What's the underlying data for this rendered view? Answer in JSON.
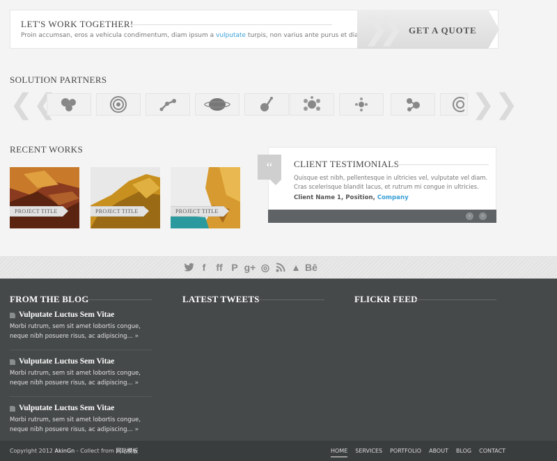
{
  "cta": {
    "title": "LET'S WORK TOGETHER!",
    "text_before": "Proin accumsan, eros a vehicula condimentum, diam ipsum a ",
    "text_link": "vulputate",
    "text_after": " turpis, non varius ante purus et diam.",
    "button": "GET A QUOTE"
  },
  "partners": {
    "title": "SOLUTION PARTNERS",
    "prev_icon": "double-chevron-left-icon",
    "next_icon": "double-chevron-right-icon"
  },
  "recent_works": {
    "title": "RECENT WORKS",
    "items": [
      {
        "label": "PROJECT TITLE"
      },
      {
        "label": "PROJECT TITLE"
      },
      {
        "label": "PROJECT TITLE"
      }
    ]
  },
  "testimonials": {
    "title": "CLIENT TESTIMONIALS",
    "quote_mark": "“",
    "text": "Quisque est nibh, pellentesque in ultricies vel, vulputate vel diam. Cras scelerisque blandit lacus, et rutrum mi congue in ultricies.",
    "client": "Client Name 1, Position, ",
    "company": "Company",
    "prev": "‹",
    "next": "›"
  },
  "social": {
    "icons": [
      "twitter-icon",
      "facebook-icon",
      "friendfeed-icon",
      "pinterest-icon",
      "google-plus-icon",
      "dribbble-icon",
      "rss-icon",
      "forrst-icon",
      "behance-icon"
    ],
    "glyphs": [
      "🐦",
      "f",
      "ff",
      "P",
      "g+",
      "◎",
      "≋",
      "▲",
      "Bē"
    ]
  },
  "footer": {
    "blog_title": "FROM THE BLOG",
    "tweets_title": "LATEST TWEETS",
    "flickr_title": "FLICKR FEED",
    "blog_items": [
      {
        "title": "Vulputate Luctus Sem Vitae",
        "text": "Morbi rutrum, sem sit amet lobortis congue, neque nibh posuere risus, ac adipiscing...",
        "more": " »"
      },
      {
        "title": "Vulputate Luctus Sem Vitae",
        "text": "Morbi rutrum, sem sit amet lobortis congue, neque nibh posuere risus, ac adipiscing...",
        "more": " »"
      },
      {
        "title": "Vulputate Luctus Sem Vitae",
        "text": "Morbi rutrum, sem sit amet lobortis congue, neque nibh posuere risus, ac adipiscing...",
        "more": " »"
      }
    ]
  },
  "bottom": {
    "copy_prefix": "Copyright 2012 ",
    "copy_author": "AkinGn",
    "copy_mid": " - Collect from ",
    "copy_site": "网站模板",
    "nav": [
      "HOME",
      "SERVICES",
      "PORTFOLIO",
      "ABOUT",
      "BLOG",
      "CONTACT"
    ]
  }
}
